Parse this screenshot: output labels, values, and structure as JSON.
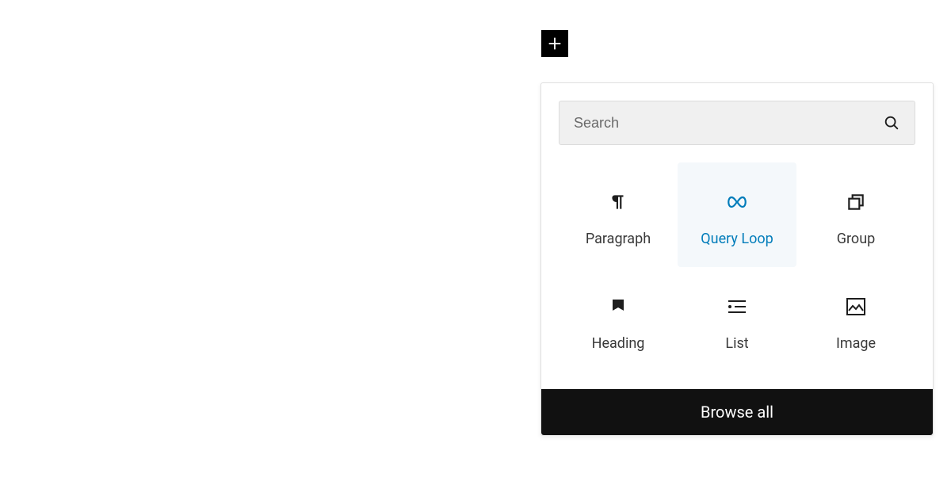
{
  "add_button": {
    "title": "Add block"
  },
  "search": {
    "placeholder": "Search"
  },
  "blocks": [
    {
      "id": "paragraph",
      "label": "Paragraph",
      "highlight": false
    },
    {
      "id": "query-loop",
      "label": "Query Loop",
      "highlight": true
    },
    {
      "id": "group",
      "label": "Group",
      "highlight": false
    },
    {
      "id": "heading",
      "label": "Heading",
      "highlight": false
    },
    {
      "id": "list",
      "label": "List",
      "highlight": false
    },
    {
      "id": "image",
      "label": "Image",
      "highlight": false
    }
  ],
  "browse_all_label": "Browse all",
  "colors": {
    "accent": "#007cba",
    "dark": "#111111"
  }
}
